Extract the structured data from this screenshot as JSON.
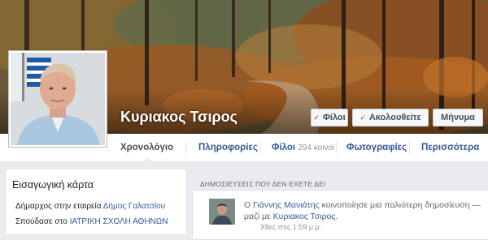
{
  "profile": {
    "name": "Κυριακος Τσιρος"
  },
  "cover_actions": {
    "friends": "Φίλοι",
    "follow": "Ακολουθείτε",
    "message": "Μήνυμα"
  },
  "nav": {
    "timeline": "Χρονολόγιο",
    "about": "Πληροφορίες",
    "friends": "Φίλοι",
    "friends_count": "294 κοινοί",
    "photos": "Φωτογραφίες",
    "more": "Περισσότερα"
  },
  "intro": {
    "title": "Εισαγωγική κάρτα",
    "work_prefix": "Δήμαρχος στην εταιρεία",
    "work_link": "Δήμος Γαλατσίου",
    "study_prefix": "Σπούδασε στο",
    "study_link": "ΙΑΤΡΙΚΗ ΣΧΟΛΗ ΑΘΗΝΩΝ"
  },
  "posts": {
    "header": "ΔΗΜΟΣΙΕΥΣΕΙΣ ΠΟΥ ΔΕΝ ΕΧΕΤΕ ΔΕΙ",
    "item": {
      "prefix": "Ο",
      "author": "Γιάννης Μανιάτης",
      "action": "κοινοποίησε μια παλιότερη δημοσίευση —",
      "with_prefix": "μαζί με",
      "with_name": "Κυριακος Τσιρος.",
      "time": "Χθες στις 1:59 μ.μ."
    }
  },
  "colors": {
    "link": "#365899",
    "page_bg": "#e9ebee"
  },
  "icons": {
    "friends_check": "checkmark-icon",
    "follow": "rss-icon"
  }
}
